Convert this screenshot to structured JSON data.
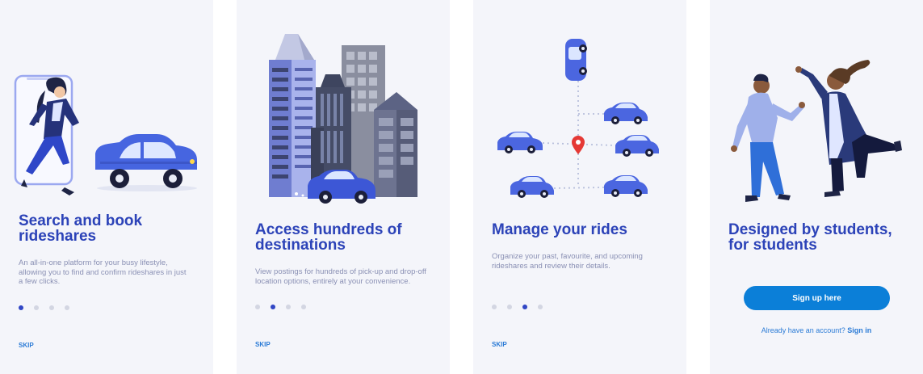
{
  "screens": [
    {
      "title": "Search and book rideshares",
      "description": "An all-in-one platform for your busy lifestyle, allowing you to find and confirm rideshares in just a few clicks.",
      "skip_label": "SKIP",
      "active_step": 1,
      "total_steps": 4
    },
    {
      "title": "Access hundreds of destinations",
      "description": "View postings for hundreds of pick-up and drop-off location options, entirely at your convenience.",
      "skip_label": "SKIP",
      "active_step": 2,
      "total_steps": 4
    },
    {
      "title": "Manage your rides",
      "description": "Organize your past, favourite, and upcoming rideshares and review their details.",
      "skip_label": "SKIP",
      "active_step": 3,
      "total_steps": 4
    },
    {
      "title": "Designed by students, for students",
      "cta_label": "Sign up here",
      "signin_prompt": "Already have an account?",
      "signin_link": "Sign in"
    }
  ],
  "colors": {
    "screen_bg": "#f4f5fa",
    "title": "#2c43b8",
    "description": "#8a90b4",
    "accent_blue": "#3147c5",
    "link_blue": "#2b7bd6",
    "cta_bg": "#0b7fd8",
    "pin_red": "#e53935",
    "dot_inactive": "#d3d6e2"
  },
  "icons": [
    "phone-person-illustration",
    "car-illustration",
    "city-skyline-illustration",
    "map-pin-icon",
    "high-five-illustration"
  ]
}
